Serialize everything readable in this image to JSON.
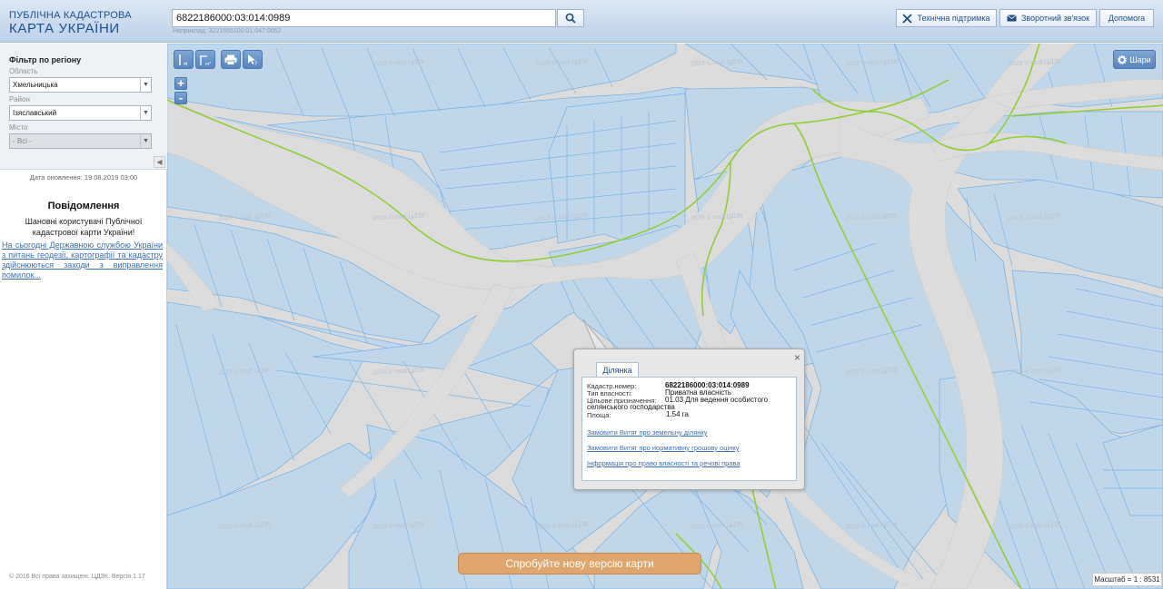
{
  "header": {
    "logo_line1": "ПУБЛІЧНА КАДАСТРОВА",
    "logo_line2": "КАРТА УКРАЇНИ",
    "search_value": "6822186000:03:014:0989",
    "search_example": "Наприклад: 3221655100:01:047:0052",
    "buttons": {
      "support": "Технічна підтримка",
      "feedback": "Зворотний зв'язок",
      "help": "Допомога"
    }
  },
  "sidebar": {
    "filter_title": "Фільтр по регіону",
    "region_label": "Область",
    "region_value": "Хмельницька",
    "district_label": "Район",
    "district_value": "Ізяславський",
    "city_label": "Місто",
    "city_value": "- Всі -",
    "update_date": "Дата оновлення: 19.08.2019 03:00",
    "notice_title": "Повідомлення",
    "notice_body": "Шановні користувачі Публічної кадастрової карти України!",
    "notice_link": "На сьогодні Державною службою України з питань геодезії, картографії та кадастру здійснюються заходи з виправлення помилок...",
    "copyright": "© 2016 Всі права захищені. ЦДЗК. Версія 1.17"
  },
  "map": {
    "layers_label": "Шари",
    "watermark": "2019 © nsdi.ЦДЗК",
    "new_version": "Спробуйте нову версію карти",
    "scale": "Масштаб = 1 : 8531",
    "colors": {
      "parcel_fill": "#c0d7ea",
      "parcel_stroke": "#78b4e6",
      "road": "#dcdcdc",
      "boundary": "#8fcf2f"
    }
  },
  "popup": {
    "tab": "Ділянка",
    "labels": {
      "cadastral": "Кадастр.номер:",
      "ownership": "Тип власності:",
      "purpose": "Цільове призначення:",
      "area": "Площа:"
    },
    "values": {
      "cadastral": "6822186000:03:014:0989",
      "ownership": "Приватна власність",
      "purpose": "01.03 Для ведення особистого",
      "purpose_cont": "селянського господарства",
      "area": "1.54 га"
    },
    "links": {
      "extract": "Замовити Витяг про земельну ділянку",
      "valuation": "Замовити Витяг про нормативну грошову оцінку",
      "rights": "Інформація про право власності та речові права"
    }
  }
}
